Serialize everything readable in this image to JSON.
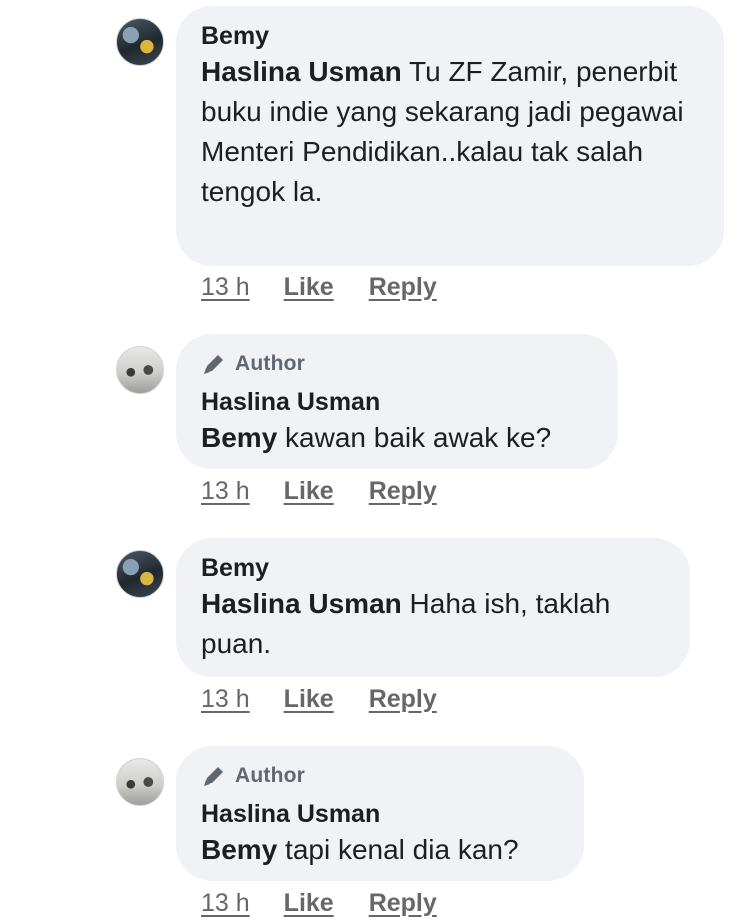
{
  "comments": [
    {
      "author": "Bemy",
      "mention": "Haslina Usman",
      "text": " Tu ZF Zamir, penerbit buku indie yang sekarang jadi pegawai Menteri Pendidikan..kalau tak salah tengok la.",
      "time": "13 h",
      "like_label": "Like",
      "reply_label": "Reply"
    },
    {
      "badge": "Author",
      "author": "Haslina Usman",
      "mention": "Bemy",
      "text": " kawan baik awak ke?",
      "time": "13 h",
      "like_label": "Like",
      "reply_label": "Reply"
    },
    {
      "author": "Bemy",
      "mention": "Haslina Usman",
      "text": " Haha ish, taklah puan.",
      "time": "13 h",
      "like_label": "Like",
      "reply_label": "Reply"
    },
    {
      "badge": "Author",
      "author": "Haslina Usman",
      "mention": "Bemy",
      "text": " tapi kenal dia kan?",
      "time": "13 h",
      "like_label": "Like",
      "reply_label": "Reply"
    }
  ],
  "colors": {
    "bubble": "#f0f2f5",
    "secondary_text": "#65676b",
    "primary_text": "#1c1e21"
  },
  "icons": {
    "badge": "pencil-icon"
  }
}
